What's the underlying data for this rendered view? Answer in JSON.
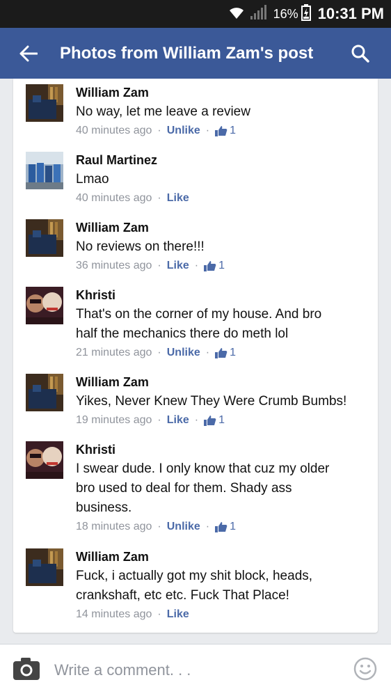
{
  "status_bar": {
    "battery_percent": "16%",
    "time": "10:31 PM",
    "icons": [
      "wifi-icon",
      "signal-icon",
      "battery-icon"
    ]
  },
  "app_bar": {
    "title": "Photos from William Zam's post",
    "back_icon": "back-arrow-icon",
    "search_icon": "search-icon",
    "color": "#3b5998"
  },
  "comments": [
    {
      "author": "William Zam",
      "lines": [
        "No way, let me leave a review"
      ],
      "time": "40 minutes ago",
      "action": "Unlike",
      "likes": "1",
      "avatar": "william"
    },
    {
      "author": "Raul Martinez",
      "lines": [
        "Lmao"
      ],
      "time": "40 minutes ago",
      "action": "Like",
      "likes": "",
      "avatar": "raul"
    },
    {
      "author": "William Zam",
      "lines": [
        "No reviews on there!!!"
      ],
      "time": "36 minutes ago",
      "action": "Like",
      "likes": "1",
      "avatar": "william"
    },
    {
      "author": "Khristi",
      "lines": [
        "That's on the corner of my house. And bro",
        "half the mechanics there do meth lol"
      ],
      "time": "21 minutes ago",
      "action": "Unlike",
      "likes": "1",
      "avatar": "khristi"
    },
    {
      "author": "William Zam",
      "lines": [
        "Yikes, Never Knew They Were Crumb Bumbs!"
      ],
      "time": "19 minutes ago",
      "action": "Like",
      "likes": "1",
      "avatar": "william"
    },
    {
      "author": "Khristi",
      "lines": [
        "I swear dude. I only know that cuz my older",
        "bro used to deal for them. Shady ass",
        "business."
      ],
      "time": "18 minutes ago",
      "action": "Unlike",
      "likes": "1",
      "avatar": "khristi"
    },
    {
      "author": "William Zam",
      "lines": [
        "Fuck, i actually got my shit block, heads,",
        "crankshaft, etc etc. Fuck That Place!"
      ],
      "time": "14 minutes ago",
      "action": "Like",
      "likes": "",
      "avatar": "william"
    }
  ],
  "composer": {
    "placeholder": "Write a comment. . .",
    "camera_icon": "camera-icon",
    "smiley_icon": "smiley-icon"
  },
  "colors": {
    "link": "#4b6aa8",
    "meta": "#90949c",
    "background": "#e9ebee"
  }
}
